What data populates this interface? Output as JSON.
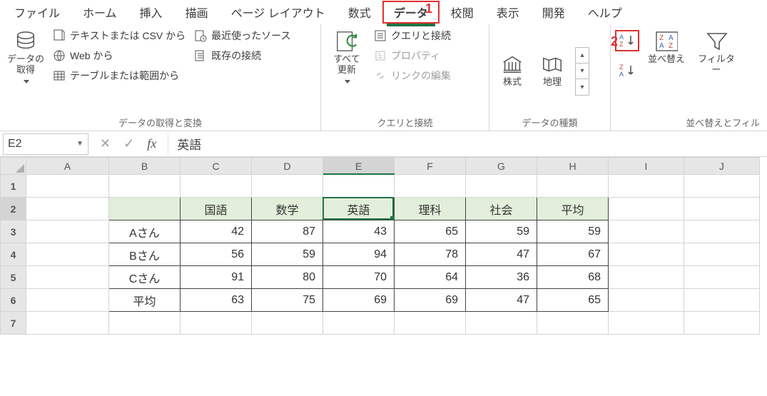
{
  "tabs": {
    "file": "ファイル",
    "home": "ホーム",
    "insert": "挿入",
    "draw": "描画",
    "layout": "ページ レイアウト",
    "formula": "数式",
    "data": "データ",
    "review": "校閲",
    "view": "表示",
    "developer": "開発",
    "help": "ヘルプ"
  },
  "callouts": {
    "one": "1",
    "two": "2"
  },
  "ribbon": {
    "g1": {
      "big": "データの\n取得",
      "csv": "テキストまたは CSV から",
      "web": "Web から",
      "table": "テーブルまたは範囲から",
      "recent": "最近使ったソース",
      "existing": "既存の接続",
      "label": "データの取得と変換"
    },
    "g2": {
      "big": "すべて\n更新",
      "conn": "クエリと接続",
      "prop": "プロパティ",
      "edit": "リンクの編集",
      "label": "クエリと接続"
    },
    "g3": {
      "stock": "株式",
      "geo": "地理",
      "label": "データの種類"
    },
    "g4": {
      "sort": "並べ替え",
      "filter": "フィルター",
      "label": "並べ替えとフィル"
    }
  },
  "fbar": {
    "cell": "E2",
    "fx": "fx",
    "value": "英語"
  },
  "cols": [
    "A",
    "B",
    "C",
    "D",
    "E",
    "F",
    "G",
    "H",
    "I",
    "J"
  ],
  "rows": [
    "1",
    "2",
    "3",
    "4",
    "5",
    "6",
    "7"
  ],
  "table": {
    "headers": [
      "",
      "国語",
      "数学",
      "英語",
      "理科",
      "社会",
      "平均"
    ],
    "rows": [
      {
        "name": "Aさん",
        "v": [
          "42",
          "87",
          "43",
          "65",
          "59",
          "59"
        ]
      },
      {
        "name": "Bさん",
        "v": [
          "56",
          "59",
          "94",
          "78",
          "47",
          "67"
        ]
      },
      {
        "name": "Cさん",
        "v": [
          "91",
          "80",
          "70",
          "64",
          "36",
          "68"
        ]
      },
      {
        "name": "平均",
        "v": [
          "63",
          "75",
          "69",
          "69",
          "47",
          "65"
        ]
      }
    ]
  },
  "chart_data": {
    "type": "table",
    "title": "",
    "columns": [
      "国語",
      "数学",
      "英語",
      "理科",
      "社会",
      "平均"
    ],
    "rows": [
      "Aさん",
      "Bさん",
      "Cさん",
      "平均"
    ],
    "values": [
      [
        42,
        87,
        43,
        65,
        59,
        59
      ],
      [
        56,
        59,
        94,
        78,
        47,
        67
      ],
      [
        91,
        80,
        70,
        64,
        36,
        68
      ],
      [
        63,
        75,
        69,
        69,
        47,
        65
      ]
    ]
  }
}
